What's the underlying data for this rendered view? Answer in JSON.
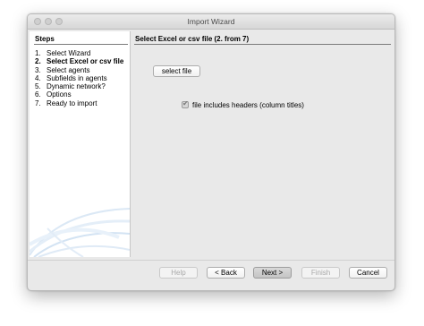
{
  "window": {
    "title": "Import Wizard"
  },
  "sidebar": {
    "header": "Steps",
    "steps": [
      {
        "num": "1.",
        "label": "Select Wizard",
        "current": false
      },
      {
        "num": "2.",
        "label": "Select Excel or csv file",
        "current": true
      },
      {
        "num": "3.",
        "label": "Select agents",
        "current": false
      },
      {
        "num": "4.",
        "label": "Subfields in agents",
        "current": false
      },
      {
        "num": "5.",
        "label": "Dynamic network?",
        "current": false
      },
      {
        "num": "6.",
        "label": "Options",
        "current": false
      },
      {
        "num": "7.",
        "label": "Ready to import",
        "current": false
      }
    ]
  },
  "content": {
    "header": "Select Excel or csv file (2. from 7)",
    "select_file_label": "select file",
    "headers_checkbox": {
      "label": "file includes headers (column titles)",
      "checked": true,
      "disabled": true
    }
  },
  "footer": {
    "help": "Help",
    "back": "< Back",
    "next": "Next >",
    "finish": "Finish",
    "cancel": "Cancel"
  }
}
